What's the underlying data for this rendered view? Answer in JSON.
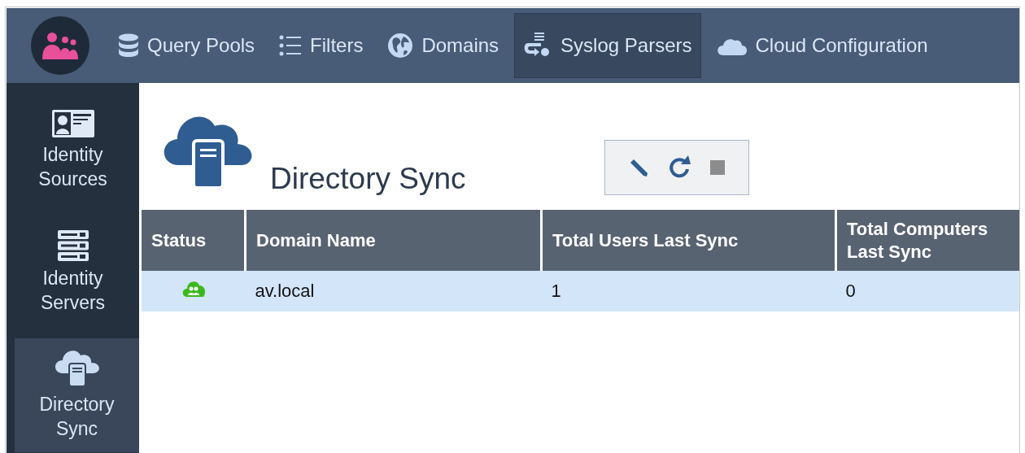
{
  "nav": [
    {
      "kind": "database",
      "label": "Query Pools",
      "selected": false
    },
    {
      "kind": "list",
      "label": "Filters",
      "selected": false
    },
    {
      "kind": "globe",
      "label": "Domains",
      "selected": false
    },
    {
      "kind": "syslog",
      "label": "Syslog Parsers",
      "selected": true
    },
    {
      "kind": "cloud",
      "label": "Cloud Configuration",
      "selected": false
    }
  ],
  "sidebar": {
    "items": [
      {
        "kind": "idcard",
        "label": "Identity Sources",
        "selected": false
      },
      {
        "kind": "servers",
        "label": "Identity Servers",
        "selected": false
      },
      {
        "kind": "cloudsync",
        "label": "Directory Sync",
        "selected": true
      }
    ]
  },
  "page": {
    "title": "Directory Sync"
  },
  "toolbar": [
    {
      "kind": "edit",
      "disabled": false
    },
    {
      "kind": "refresh",
      "disabled": false
    },
    {
      "kind": "stop",
      "disabled": true
    }
  ],
  "table": {
    "columns": [
      "Status",
      "Domain Name",
      "Total Users Last Sync",
      "Total Computers Last Sync"
    ],
    "rows": [
      {
        "selected": true,
        "cells": [
          "",
          "av.local",
          "1",
          "0"
        ]
      }
    ]
  }
}
